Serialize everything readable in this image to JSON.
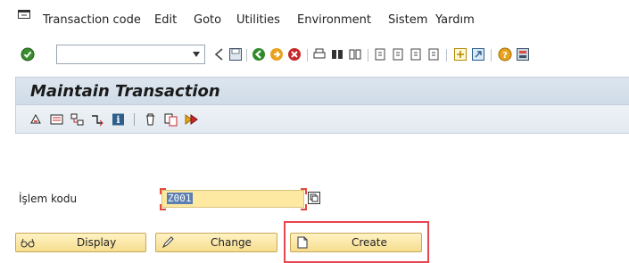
{
  "menubar": {
    "items": [
      "Transaction code",
      "Edit",
      "Goto",
      "Utilities",
      "Environment",
      "Sistem",
      "Yardım"
    ]
  },
  "toolbar": {
    "command_field_value": "",
    "icons": [
      "enter-icon",
      "dropdown-icon",
      "back-icon",
      "save-icon",
      "back-arrow-icon",
      "exit-icon",
      "cancel-icon",
      "print-icon",
      "find-icon",
      "find-next-icon",
      "first-page-icon",
      "previous-page-icon",
      "next-page-icon",
      "last-page-icon",
      "new-session-icon",
      "shortcut-icon",
      "help-icon",
      "customize-layout-icon"
    ]
  },
  "screen": {
    "title": "Maintain Transaction",
    "app_toolbar_icons": [
      "other-object-icon",
      "display-object-list-icon",
      "where-used-icon",
      "transport-icon",
      "info-icon",
      "delete-icon",
      "copy-icon",
      "test-icon"
    ]
  },
  "form": {
    "tcode_label": "İşlem kodu",
    "tcode_value": "Z001"
  },
  "buttons": {
    "display": "Display",
    "change": "Change",
    "create": "Create"
  },
  "colors": {
    "button_bg": "#f6dd8e",
    "input_bg": "#fde9a2",
    "highlight": "#e8444e",
    "title_bar": "#d5e0eb"
  }
}
